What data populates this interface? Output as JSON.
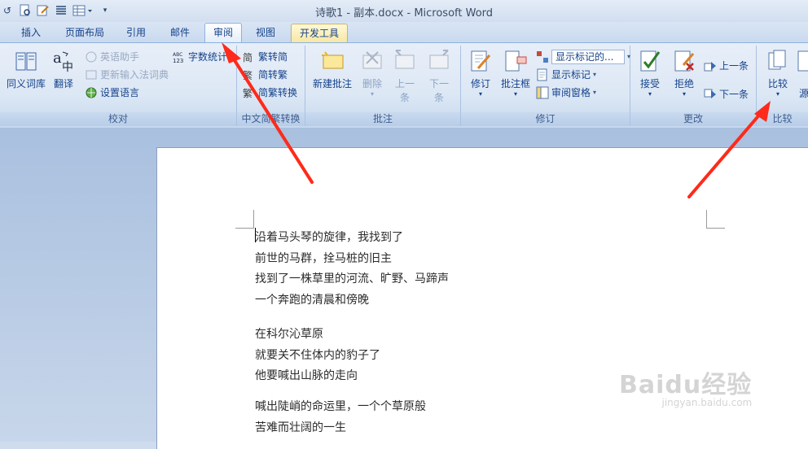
{
  "window": {
    "title": "诗歌1 - 副本.docx - Microsoft Word"
  },
  "tabs": [
    {
      "label": "插入"
    },
    {
      "label": "页面布局"
    },
    {
      "label": "引用"
    },
    {
      "label": "邮件"
    },
    {
      "label": "审阅",
      "active": true
    },
    {
      "label": "视图"
    },
    {
      "label": "开发工具"
    }
  ],
  "ribbon": {
    "proofing": {
      "label": "校对",
      "thesaurus": "同义词库",
      "translate": "翻译",
      "english_assistant": "英语助手",
      "update_ime": "更新输入法词典",
      "set_language": "设置语言",
      "word_count": "字数统计"
    },
    "chinese_convert": {
      "label": "中文简繁转换",
      "trad_to_simp": "繁转简",
      "simp_to_trad": "简转繁",
      "convert": "简繁转换"
    },
    "comments": {
      "label": "批注",
      "new": "新建批注",
      "delete": "删除",
      "prev_line1": "上一",
      "prev_line2": "条",
      "next_line1": "下一",
      "next_line2": "条"
    },
    "tracking": {
      "label": "修订",
      "track_changes": "修订",
      "balloons": "批注框",
      "display_for_review": "显示标记的...",
      "show_markup": "显示标记",
      "reviewing_pane": "审阅窗格"
    },
    "changes": {
      "label": "更改",
      "accept": "接受",
      "reject": "拒绝",
      "previous": "上一条",
      "next": "下一条"
    },
    "compare": {
      "label": "比较",
      "compare": "比较",
      "source_partial": "源"
    }
  },
  "document": {
    "lines": [
      "沿着马头琴的旋律，我找到了",
      "前世的马群，拴马桩的旧主",
      "找到了一株草里的河流、旷野、马蹄声",
      "一个奔跑的清晨和傍晚",
      "在科尔沁草原",
      "就要关不住体内的豹子了",
      "他要喊出山脉的走向",
      "喊出陡峭的命运里，一个个草原般",
      "苦难而壮阔的一生"
    ]
  },
  "watermark": {
    "logo": "Baidu经验",
    "url": "jingyan.baidu.com"
  },
  "colors": {
    "annotation_arrow": "#ff2a1a",
    "ribbon_text": "#15428b"
  }
}
